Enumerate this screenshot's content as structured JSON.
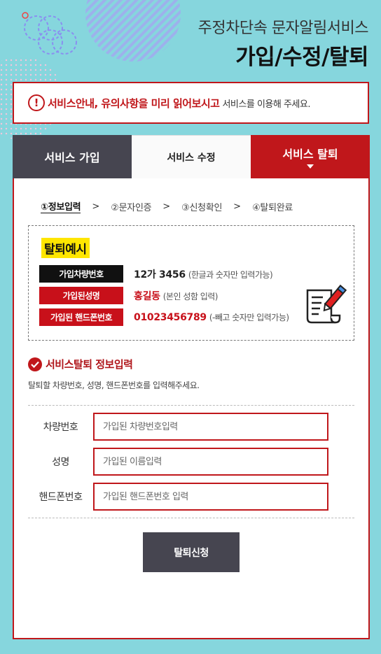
{
  "header": {
    "subtitle": "주정차단속 문자알림서비스",
    "title": "가입/수정/탈퇴"
  },
  "notice": {
    "icon": "exclamation-icon",
    "strong": "서비스안내, 유의사항을 미리 읽어보시고",
    "rest": "서비스를 이용해 주세요."
  },
  "tabs": [
    {
      "label": "서비스 가입"
    },
    {
      "label": "서비스 수정"
    },
    {
      "label": "서비스 탈퇴"
    }
  ],
  "steps": [
    {
      "label": "①정보입력"
    },
    {
      "label": "②문자인증"
    },
    {
      "label": "③신청확인"
    },
    {
      "label": "④탈퇴완료"
    }
  ],
  "example": {
    "title": "탈퇴예시",
    "rows": [
      {
        "label": "가입차량번호",
        "value": "12가 3456",
        "note": "(한글과 숫자만 입력가능)"
      },
      {
        "label": "가입된성명",
        "value": "홍길동",
        "note": "(본인 성함 입력)"
      },
      {
        "label": "가입된 핸드폰번호",
        "value": "01023456789",
        "note": "(-빼고 숫자만 입력가능)"
      }
    ]
  },
  "section": {
    "title": "서비스탈퇴 정보입력",
    "desc": "탈퇴할 차량번호, 성명, 핸드폰번호를 입력해주세요."
  },
  "form": {
    "car": {
      "label": "차량번호",
      "placeholder": "가입된 차량번호입력"
    },
    "name": {
      "label": "성명",
      "placeholder": "가입된 이름입력"
    },
    "phone": {
      "label": "핸드폰번호",
      "placeholder": "가입된 핸드폰번호 입력"
    },
    "submit": "탈퇴신청"
  },
  "colors": {
    "background": "#86d6dd",
    "accent": "#c0171b",
    "dark": "#464550",
    "highlight": "#ffe600"
  }
}
